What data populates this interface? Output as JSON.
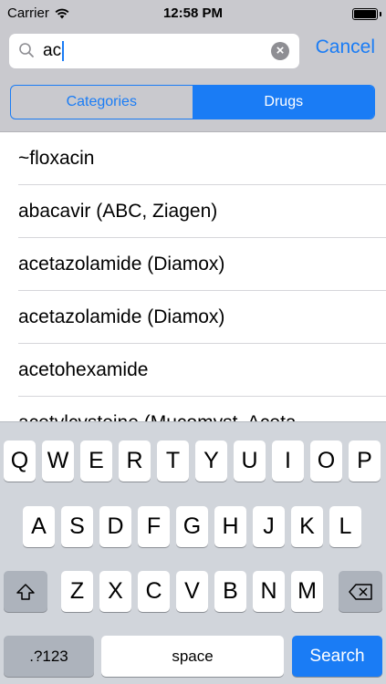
{
  "status_bar": {
    "carrier": "Carrier",
    "time": "12:58 PM",
    "icons": [
      "wifi-icon",
      "battery-icon"
    ]
  },
  "search": {
    "value": "ac",
    "cancel_label": "Cancel",
    "icon": "search-icon",
    "clear_icon": "clear-icon"
  },
  "segments": [
    {
      "label": "Categories",
      "selected": false
    },
    {
      "label": "Drugs",
      "selected": true
    }
  ],
  "results": [
    "~floxacin",
    "abacavir (ABC, Ziagen)",
    "acetazolamide (Diamox)",
    "acetazolamide (Diamox)",
    "acetohexamide",
    "acetylcysteine (Mucomyst, Aceta"
  ],
  "keyboard": {
    "row1": [
      "Q",
      "W",
      "E",
      "R",
      "T",
      "Y",
      "U",
      "I",
      "O",
      "P"
    ],
    "row2": [
      "A",
      "S",
      "D",
      "F",
      "G",
      "H",
      "J",
      "K",
      "L"
    ],
    "row3": [
      "Z",
      "X",
      "C",
      "V",
      "B",
      "N",
      "M"
    ],
    "numbers_label": ".?123",
    "space_label": "space",
    "search_label": "Search",
    "shift_icon": "shift-icon",
    "backspace_icon": "backspace-icon"
  },
  "colors": {
    "accent": "#1a7cf5",
    "header_bg": "#c9c9ce",
    "keyboard_bg": "#d1d5db"
  }
}
